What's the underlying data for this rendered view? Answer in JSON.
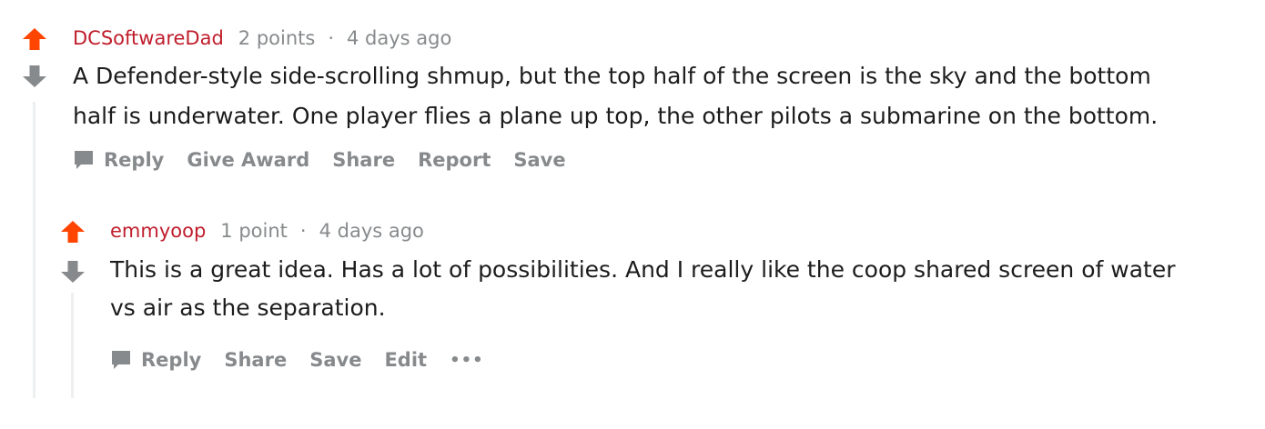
{
  "comments": [
    {
      "author": "DCSoftwareDad",
      "points": "2 points",
      "separator": "·",
      "time": "4 days ago",
      "body_lines": [
        "A Defender-style side-scrolling shmup, but the top half of the screen is the sky and the bottom",
        "half is underwater. One player flies a plane up top, the other pilots a submarine on the bottom."
      ],
      "actions": {
        "reply": "Reply",
        "give_award": "Give Award",
        "share": "Share",
        "report": "Report",
        "save": "Save"
      },
      "upvoted": true
    },
    {
      "author": "emmyoop",
      "points": "1 point",
      "separator": "·",
      "time": "4 days ago",
      "body_lines": [
        "This is a great idea. Has a lot of possibilities. And I really like the coop shared screen of water",
        "vs air as the separation."
      ],
      "actions": {
        "reply": "Reply",
        "share": "Share",
        "save": "Save",
        "edit": "Edit",
        "more": "•••"
      },
      "upvoted": true
    }
  ],
  "colors": {
    "upvote": "#ff4500",
    "downvote": "#878a8c",
    "author": "#c01d2c",
    "meta": "#878a8c",
    "body": "#1c1c1c",
    "thread_line": "#edeff1"
  },
  "icons": {
    "upvote": "arrow-up-icon",
    "downvote": "arrow-down-icon",
    "reply": "speech-bubble-icon",
    "more": "more-horizontal-icon"
  }
}
